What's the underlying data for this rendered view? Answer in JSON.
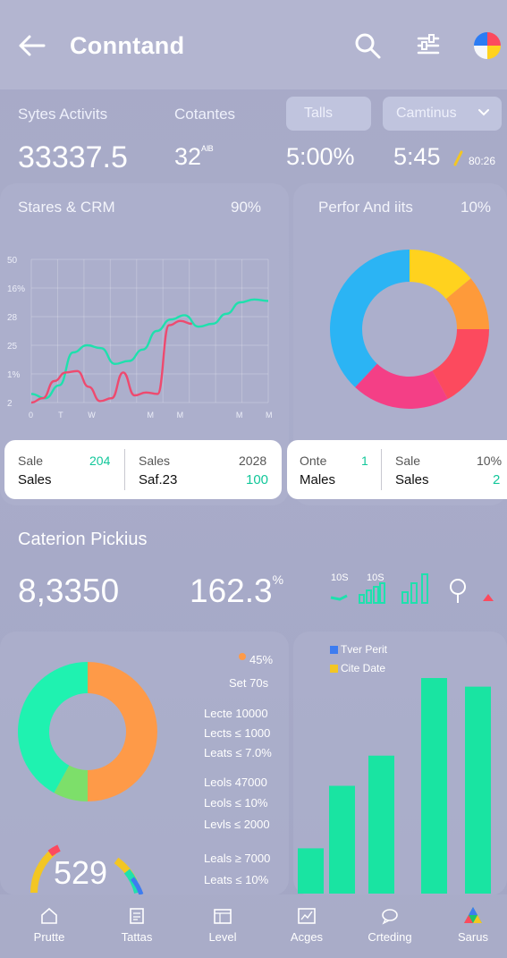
{
  "header": {
    "title": "Conntand",
    "back_icon": "arrow-left-icon",
    "search_icon": "search-icon",
    "filter_icon": "sliders-icon",
    "avatar_icon": "pie-avatar-icon"
  },
  "stats": {
    "label1": "Sytes Activits",
    "label2": "Cotantes",
    "chip1": "Talls",
    "chip2": "Camtinus",
    "value1": "33337.5",
    "value2": "32",
    "value2_suffix": "ᴬᴵᴮ",
    "value3": "5:00%",
    "value4": "5:45",
    "value4_small": "80:26"
  },
  "sales_card": {
    "title": "Stares & CRM",
    "percent": "90%",
    "y_ticks": [
      "50",
      "16%",
      "28",
      "25",
      "1%",
      "2"
    ],
    "x_ticks": [
      "0",
      "T",
      "W",
      "",
      "M",
      "M",
      "",
      "M",
      "M"
    ],
    "summary": {
      "left_label": "Sale",
      "left_label_value": "204",
      "left_title": "Sales",
      "right_label": "Sales",
      "right_label_value": "2028",
      "right_title": "Saf.23",
      "right_value": "100"
    }
  },
  "perf_card": {
    "title": "Perfor And iits",
    "percent": "10%",
    "summary": {
      "left_label": "Onte",
      "left_label_value": "1",
      "left_title": "Males",
      "right_label": "Sale",
      "right_label_value": "10%",
      "right_title": "Sales",
      "right_value": "2"
    }
  },
  "section2": {
    "title": "Caterion Pickius",
    "value1": "8,3350",
    "value2": "162.3",
    "value2_suffix": "%",
    "mini1_label": "10S",
    "mini2_label": "10S"
  },
  "legend_list": {
    "top1": "45%",
    "top2": "Set 70s",
    "items": [
      "Lecte 10000",
      "Lects ≤ 1000",
      "Leats ≤ 7.0%",
      "Leols 47000",
      "Leols ≤ 10%",
      "Levls ≤ 2000",
      "Leals ≥ 7000",
      "Leats ≤ 10%"
    ]
  },
  "gauge": {
    "value": "529"
  },
  "bar_chart": {
    "legend": [
      {
        "name": "Tver Perit",
        "color": "#3d7cf0"
      },
      {
        "name": "Cite Date",
        "color": "#f3c623"
      }
    ]
  },
  "nav": [
    {
      "label": "Prutte",
      "icon": "home-icon"
    },
    {
      "label": "Tattas",
      "icon": "document-icon"
    },
    {
      "label": "Level",
      "icon": "layers-icon"
    },
    {
      "label": "Acges",
      "icon": "chart-icon"
    },
    {
      "label": "Crteding",
      "icon": "chat-icon"
    },
    {
      "label": "Sarus",
      "icon": "triangle-logo-icon"
    }
  ],
  "chart_data": [
    {
      "type": "line",
      "title": "Stares & CRM",
      "x": [
        0,
        1,
        2,
        3,
        4,
        5,
        6,
        7,
        8,
        9,
        10,
        11,
        12,
        13,
        14,
        15,
        16,
        17,
        18,
        19,
        20,
        21,
        22,
        23,
        24,
        25,
        26,
        27
      ],
      "ylim": [
        0,
        100
      ],
      "series": [
        {
          "color": "#1fe0ad",
          "values": [
            6,
            3,
            12,
            35,
            40,
            38,
            27,
            29,
            37,
            50,
            58,
            61,
            53,
            55,
            62,
            70,
            72,
            71
          ]
        },
        {
          "color": "#ee4a6f",
          "values": [
            0,
            3,
            15,
            21,
            22,
            11,
            1,
            3,
            21,
            5,
            7,
            6,
            54,
            57,
            55
          ]
        }
      ]
    },
    {
      "type": "pie",
      "title": "Perfor And iits",
      "slices": [
        {
          "value": 14,
          "color": "#ffd21e"
        },
        {
          "value": 11,
          "color": "#fe9a3a"
        },
        {
          "value": 17,
          "color": "#fc4a5e"
        },
        {
          "value": 20,
          "color": "#f43f86"
        },
        {
          "value": 38,
          "color": "#2bb4f4"
        }
      ]
    },
    {
      "type": "pie",
      "slices": [
        {
          "value": 50,
          "color": "#fe9a48"
        },
        {
          "value": 8,
          "color": "#7ddf6a"
        },
        {
          "value": 42,
          "color": "#1ff2b0"
        }
      ]
    },
    {
      "type": "bar",
      "categories": [
        "1",
        "2",
        "3",
        "4",
        "5"
      ],
      "values": [
        21,
        50,
        64,
        100,
        96
      ],
      "color": "#19e4a2"
    }
  ]
}
